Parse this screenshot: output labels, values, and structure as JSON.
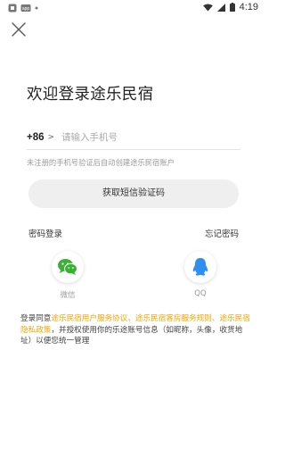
{
  "status_bar": {
    "time": "4:19"
  },
  "header": {
    "title": "欢迎登录途乐民宿"
  },
  "phone": {
    "country_code": "+86",
    "arrow": ">",
    "placeholder": "请输入手机号"
  },
  "hint": "未注册的手机号验证后自动创建途乐民宿账户",
  "sms_button_label": "获取短信验证码",
  "links": {
    "password_login": "密码登录",
    "forgot_password": "忘记密码"
  },
  "social": {
    "wechat_label": "微信",
    "qq_label": "QQ"
  },
  "agreement": {
    "prefix": "登录同意",
    "user_agreement": "途乐民宿用户服务协议、",
    "host_rules": "途乐民宿客房服务规则、",
    "privacy": "途乐民宿隐私政策",
    "suffix": "，并授权使用你的乐途账号信息（如昵称，头像，收货地址）以便您统一管理"
  },
  "colors": {
    "accent": "#f5a300",
    "wechat": "#3cb034",
    "qq": "#2f8ff0"
  }
}
